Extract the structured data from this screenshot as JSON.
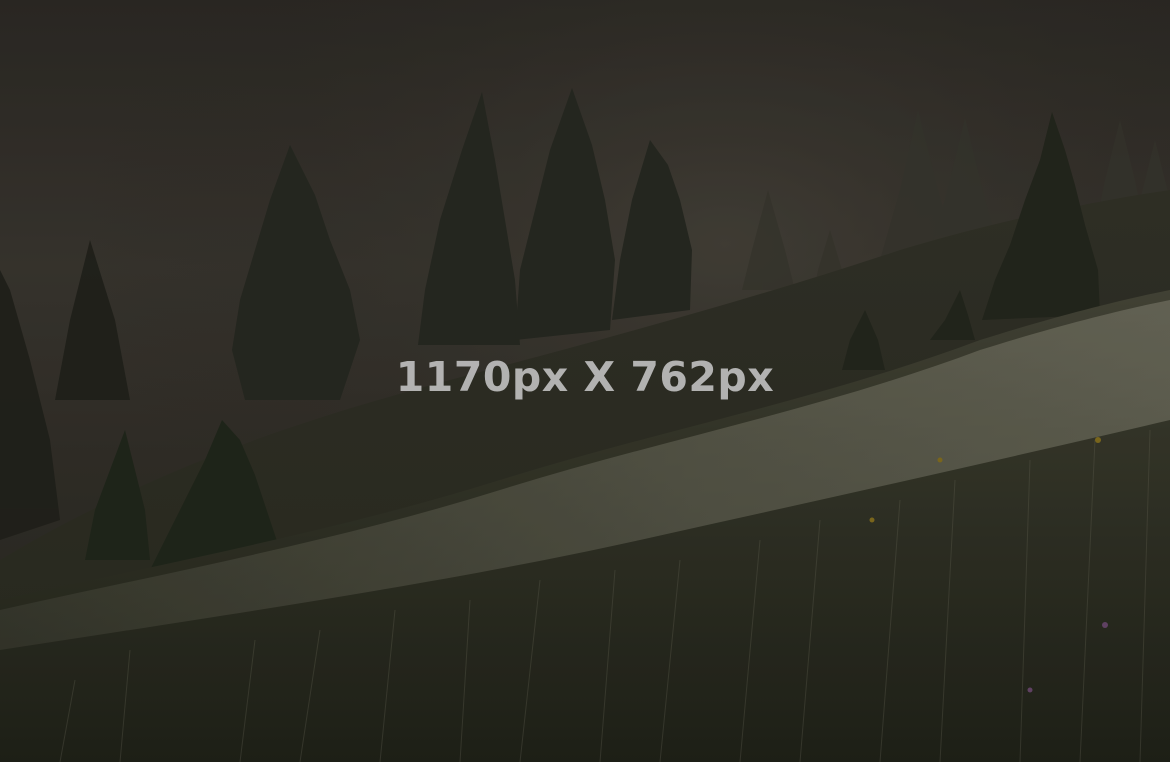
{
  "placeholder": {
    "label": "1170px X 762px"
  }
}
